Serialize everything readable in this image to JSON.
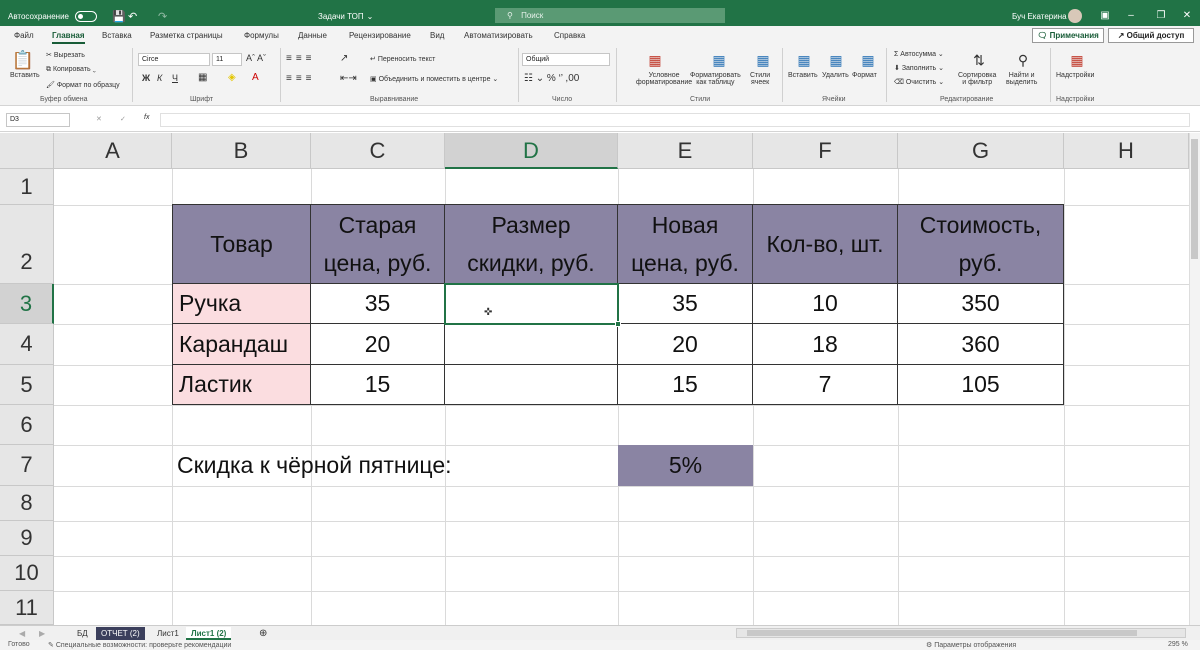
{
  "titlebar": {
    "autosave_label": "Автосохранение",
    "title": "Задачи ТОП",
    "title_chevron": "⌄",
    "search_placeholder": "Поиск",
    "user": "Буч Екатерина"
  },
  "menu": {
    "tabs": [
      "Файл",
      "Главная",
      "Вставка",
      "Разметка страницы",
      "Формулы",
      "Данные",
      "Рецензирование",
      "Вид",
      "Автоматизировать",
      "Справка"
    ],
    "active_index": 1,
    "comments_button": "Примечания",
    "share_button": "Общий доступ"
  },
  "ribbon": {
    "clipboard": {
      "paste": "Вставить",
      "cut": "Вырезать",
      "copy": "Копировать",
      "format_painter": "Формат по образцу",
      "group": "Буфер обмена"
    },
    "font": {
      "name": "Circe",
      "size": "11",
      "bold": "Ж",
      "italic": "К",
      "underline": "Ч",
      "group": "Шрифт"
    },
    "alignment": {
      "wrap": "Переносить текст",
      "merge": "Объединить и поместить в центре",
      "group": "Выравнивание"
    },
    "number": {
      "format": "Общий",
      "group": "Число"
    },
    "styles": {
      "conditional": [
        "Условное",
        "форматирование"
      ],
      "table": [
        "Форматировать",
        "как таблицу"
      ],
      "cell_styles": [
        "Стили",
        "ячеек"
      ],
      "group": "Стили"
    },
    "cells": {
      "insert": "Вставить",
      "delete": "Удалить",
      "format": "Формат",
      "group": "Ячейки"
    },
    "editing": {
      "autosum": "Автосумма",
      "fill": "Заполнить",
      "clear": "Очистить",
      "sort": [
        "Сортировка",
        "и фильтр"
      ],
      "find": [
        "Найти и",
        "выделить"
      ],
      "group": "Редактирование"
    },
    "addins": {
      "label": "Надстройки",
      "group": "Надстройки"
    }
  },
  "formula_bar": {
    "name_box": "D3",
    "fx": "fx",
    "value": ""
  },
  "columns": [
    "A",
    "B",
    "C",
    "D",
    "E",
    "F",
    "G",
    "H"
  ],
  "rows": [
    "1",
    "2",
    "3",
    "4",
    "5",
    "6",
    "7",
    "8",
    "9",
    "10",
    "11"
  ],
  "selected_cell": "D3",
  "table": {
    "headers": [
      [
        "Товар"
      ],
      [
        "Старая",
        "цена, руб."
      ],
      [
        "Размер",
        "скидки, руб."
      ],
      [
        "Новая",
        "цена, руб."
      ],
      [
        "Кол-во, шт."
      ],
      [
        "Стоимость,",
        "руб."
      ]
    ],
    "rows": [
      {
        "product": "Ручка",
        "old_price": "35",
        "discount": "",
        "new_price": "35",
        "qty": "10",
        "cost": "350"
      },
      {
        "product": "Карандаш",
        "old_price": "20",
        "discount": "",
        "new_price": "20",
        "qty": "18",
        "cost": "360"
      },
      {
        "product": "Ластик",
        "old_price": "15",
        "discount": "",
        "new_price": "15",
        "qty": "7",
        "cost": "105"
      }
    ]
  },
  "discount": {
    "label": "Скидка к чёрной пятнице:",
    "value": "5%"
  },
  "sheets": [
    "БД",
    "ОТЧЕТ (2)",
    "Лист1",
    "Лист1 (2)"
  ],
  "active_sheet": "Лист1 (2)",
  "status": {
    "ready": "Готово",
    "accessibility": "Специальные возможности: проверьте рекомендации",
    "display": "Параметры отображения",
    "zoom": "295 %"
  },
  "colors": {
    "accent": "#217346",
    "header_fill": "#8a84a3",
    "product_fill": "#fbdde0"
  }
}
